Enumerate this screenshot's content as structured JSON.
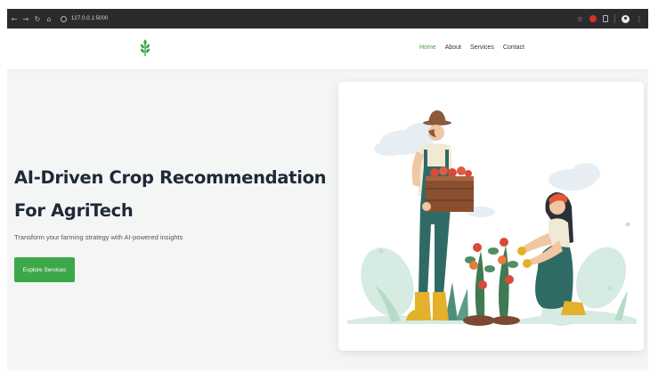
{
  "browser": {
    "url": "127.0.0.1:5000",
    "nav_icons": [
      "back-icon",
      "forward-icon",
      "reload-icon",
      "home-icon"
    ],
    "toolbar_icons": [
      "star-icon",
      "extension-icon",
      "sidebar-icon",
      "profile-icon",
      "menu-icon"
    ]
  },
  "header": {
    "logo_icon": "sprout-icon",
    "nav": [
      {
        "label": "Home",
        "active": true
      },
      {
        "label": "About",
        "active": false
      },
      {
        "label": "Services",
        "active": false
      },
      {
        "label": "Contact",
        "active": false
      }
    ]
  },
  "hero": {
    "title": "AI-Driven Crop Recommendation For AgriTech",
    "subtitle": "Transform your farming strategy with AI-powered insights",
    "cta_label": "Explore Services"
  },
  "illustration": {
    "name": "farmers-illustration"
  },
  "colors": {
    "brand_green": "#3da84a",
    "chrome_bg": "#2b2b2e",
    "page_bg": "#f4f5f5",
    "title_text": "#1f2937"
  }
}
